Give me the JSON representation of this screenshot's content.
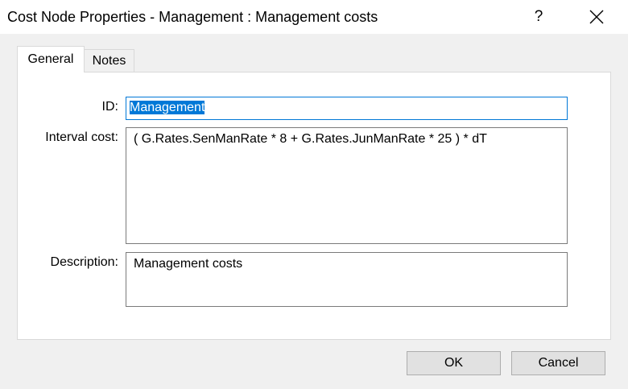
{
  "window": {
    "title": "Cost Node Properties - Management : Management costs",
    "help_label": "?",
    "close_icon": "close-icon"
  },
  "tabs": [
    {
      "label": "General",
      "selected": true
    },
    {
      "label": "Notes",
      "selected": false
    }
  ],
  "form": {
    "id_label": "ID:",
    "id_value": "Management",
    "interval_cost_label": "Interval cost:",
    "interval_cost_value": "( G.Rates.SenManRate * 8 + G.Rates.JunManRate * 25 ) * dT",
    "description_label": "Description:",
    "description_value": "Management costs"
  },
  "buttons": {
    "ok_label": "OK",
    "cancel_label": "Cancel"
  },
  "colors": {
    "dialog_background": "#f0f0f0",
    "focus_border": "#0078d7",
    "selection_highlight": "#0078d7",
    "button_face": "#e1e1e1"
  }
}
